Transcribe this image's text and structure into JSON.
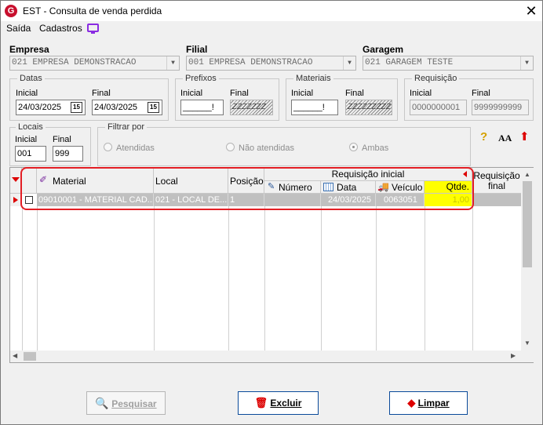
{
  "window": {
    "title": "EST - Consulta de venda perdida",
    "icon_letter": "G"
  },
  "menu": {
    "saida": "Saída",
    "cadastros": "Cadastros"
  },
  "empresa": {
    "label": "Empresa",
    "value": "021 EMPRESA DEMONSTRACAO"
  },
  "filial": {
    "label": "Filial",
    "value": "001 EMPRESA DEMONSTRACAO"
  },
  "garagem": {
    "label": "Garagem",
    "value": "021 GARAGEM TESTE"
  },
  "datas": {
    "title": "Datas",
    "inicial_label": "Inicial",
    "final_label": "Final",
    "inicial": "24/03/2025",
    "final": "24/03/2025",
    "cal": "15"
  },
  "prefixos": {
    "title": "Prefixos",
    "inicial_label": "Inicial",
    "final_label": "Final",
    "inicial_mask": "______!",
    "final_mask": "ZZZZZZZ"
  },
  "materiais": {
    "title": "Materiais",
    "inicial_label": "Inicial",
    "final_label": "Final",
    "inicial_mask": "______!",
    "final_mask": "ZZZZZZZZZ"
  },
  "requisicao": {
    "title": "Requisição",
    "inicial_label": "Inicial",
    "final_label": "Final",
    "inicial": "0000000001",
    "final": "9999999999"
  },
  "locais": {
    "title": "Locais",
    "inicial_label": "Inicial",
    "final_label": "Final",
    "inicial": "001",
    "final": "999"
  },
  "filtrar": {
    "title": "Filtrar por",
    "atendidas": "Atendidas",
    "nao_atendidas": "Não atendidas",
    "ambas": "Ambas"
  },
  "grid": {
    "headers": {
      "material": "Material",
      "local": "Local",
      "posicao": "Posição",
      "req_inicial": "Requisição inicial",
      "numero": "Número",
      "data": "Data",
      "veiculo": "Veículo",
      "qtde": "Qtde.",
      "req_final_1": "Requisição",
      "req_final_2": "final"
    },
    "row": {
      "material": "09010001 - MATERIAL CAD...",
      "local": "021 - LOCAL DE...",
      "posicao": "1",
      "numero": "",
      "data": "24/03/2025",
      "veiculo": "0063051",
      "qtde": "1,00"
    }
  },
  "buttons": {
    "pesquisar": "Pesquisar",
    "excluir": "Excluir",
    "limpar": "Limpar"
  },
  "colors": {
    "highlight": "#e31e24",
    "yellow": "#ffff00",
    "selected_row": "#c0c0c0"
  }
}
